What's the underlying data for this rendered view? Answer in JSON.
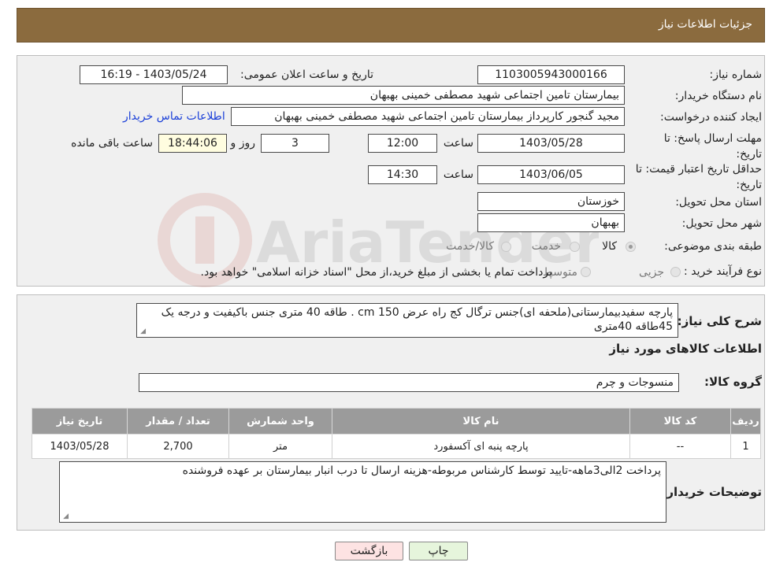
{
  "header": {
    "title": "جزئیات اطلاعات نیاز"
  },
  "form": {
    "need_number_label": "شماره نیاز:",
    "need_number": "1103005943000166",
    "announce_label": "تاریخ و ساعت اعلان عمومی:",
    "announce_value": "1403/05/24 - 16:19",
    "buyer_org_label": "نام دستگاه خریدار:",
    "buyer_org": "بیمارستان تامین اجتماعی شهید مصطفی خمینی بهبهان",
    "creator_label": "ایجاد کننده درخواست:",
    "creator": "مجید گنجور کارپرداز بیمارستان تامین اجتماعی شهید مصطفی خمینی بهبهان",
    "contact_link": "اطلاعات تماس خریدار",
    "reply_deadline_label": "مهلت ارسال پاسخ: تا تاریخ:",
    "reply_date": "1403/05/28",
    "time_label": "ساعت",
    "reply_time": "12:00",
    "days_value": "3",
    "days_label": "روز و",
    "remaining_time": "18:44:06",
    "remaining_label": "ساعت باقی مانده",
    "price_validity_label": "حداقل تاریخ اعتبار قیمت: تا تاریخ:",
    "price_date": "1403/06/05",
    "price_time": "14:30",
    "province_label": "استان محل تحویل:",
    "province": "خوزستان",
    "city_label": "شهر محل تحویل:",
    "city": "بهبهان",
    "category_label": "طبقه بندی موضوعی:",
    "category_options": [
      "کالا",
      "خدمت",
      "کالا/خدمت"
    ],
    "category_selected": "کالا",
    "process_label": "نوع فرآیند خرید :",
    "process_options": [
      "جزیی",
      "متوسط"
    ],
    "process_note": "پرداخت تمام یا بخشی از مبلغ خرید،از محل \"اسناد خزانه اسلامی\" خواهد بود."
  },
  "description": {
    "label": "شرح کلی نیاز:",
    "text": "پارچه سفیدبیمارستانی(ملحفه ای)جنس ترگال کج راه عرض cm 150 . طاقه 40 متری جنس باکیفیت و درجه یک 45طاقه 40متری"
  },
  "items_section": {
    "title": "اطلاعات کالاهای مورد نیاز",
    "group_label": "گروه کالا:",
    "group_value": "منسوجات و چرم"
  },
  "table": {
    "headers": [
      "ردیف",
      "کد کالا",
      "نام کالا",
      "واحد شمارش",
      "تعداد / مقدار",
      "تاریخ نیاز"
    ],
    "rows": [
      [
        "1",
        "--",
        "پارچه پنبه ای آکسفورد",
        "متر",
        "2,700",
        "1403/05/28"
      ]
    ]
  },
  "buyer_notes": {
    "label": "توضیحات خریدار:",
    "text": "پرداخت 2الی3ماهه-تایید توسط کارشناس مربوطه-هزینه ارسال تا درب انبار بیمارستان بر عهده فروشنده"
  },
  "buttons": {
    "print": "چاپ",
    "back": "بازگشت"
  },
  "watermark": "AriaTender.neT",
  "colors": {
    "header": "#8b6b3e",
    "panel": "#f0f0f0",
    "table_header": "#9b9b9b",
    "link": "#1a3fd8",
    "back_button": "#fde3e3",
    "print_button": "#e6f5dc"
  }
}
